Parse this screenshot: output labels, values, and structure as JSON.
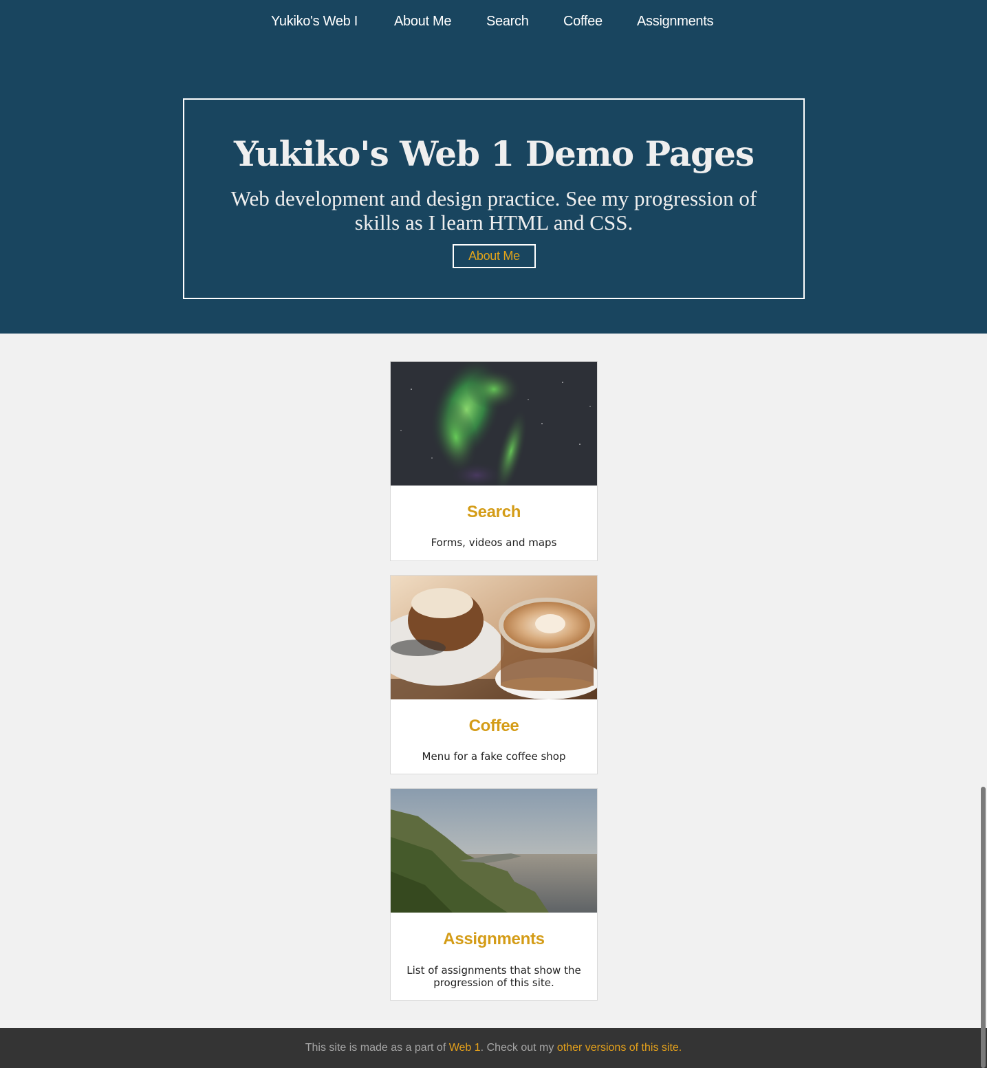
{
  "nav": {
    "items": [
      {
        "label": "Yukiko's Web I"
      },
      {
        "label": "About Me"
      },
      {
        "label": "Search"
      },
      {
        "label": "Coffee"
      },
      {
        "label": "Assignments"
      }
    ]
  },
  "hero": {
    "title": "Yukiko's Web 1 Demo Pages",
    "subtitle": "Web development and design practice. See my progression of skills as I learn HTML and CSS.",
    "button_label": "About Me"
  },
  "cards": [
    {
      "title": "Search",
      "text": "Forms, videos and maps",
      "image_icon": "aurora-image"
    },
    {
      "title": "Coffee",
      "text": "Menu for a fake coffee shop",
      "image_icon": "coffee-image"
    },
    {
      "title": "Assignments",
      "text": "List of assignments that show the progression of this site.",
      "image_icon": "coast-image"
    }
  ],
  "footer": {
    "text_1": "This site is made as a part of ",
    "link_1": "Web 1",
    "text_2": ". Check out my ",
    "link_2": "other versions of this site."
  },
  "colors": {
    "header_bg": "#19455f",
    "accent": "#d49c17",
    "footer_bg": "#343434",
    "page_bg": "#f1f1f1"
  }
}
